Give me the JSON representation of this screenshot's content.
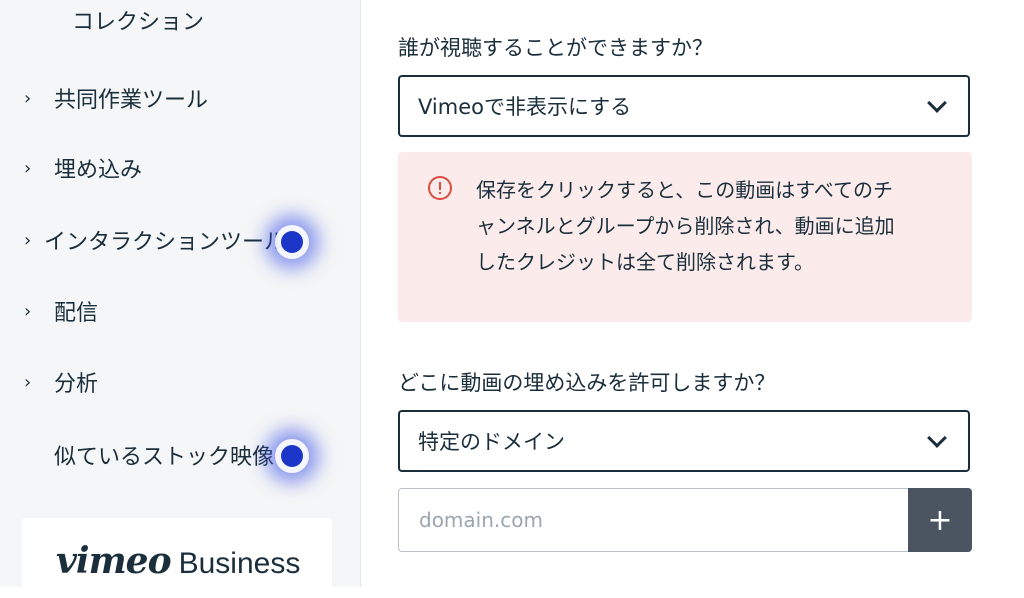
{
  "sidebar": {
    "collection_label": "コレクション",
    "items": [
      {
        "label": "共同作業ツール",
        "chevron": "›"
      },
      {
        "label": "埋め込み",
        "chevron": "›"
      },
      {
        "label": "インタラクションツール",
        "chevron": "›"
      },
      {
        "label": "配信",
        "chevron": "›"
      },
      {
        "label": "分析",
        "chevron": "›"
      },
      {
        "label": "似ているストック映像"
      }
    ],
    "brand": {
      "wordmark": "vimeo",
      "suffix": "Business"
    }
  },
  "privacy": {
    "question": "誰が視聴することができますか？",
    "selected": "Vimeoで非表示にする",
    "warning_text": "保存をクリックすると、この動画はすべてのチャンネルとグループから削除され、動画に追加したクレジットは全て削除されます。"
  },
  "embed": {
    "question": "どこに動画の埋め込みを許可しますか？",
    "selected": "特定のドメイン",
    "domain_placeholder": "domain.com",
    "add_label": "+"
  },
  "colors": {
    "warning_bg": "#fbeceb",
    "warning_icon": "#e0493f",
    "cursor_highlight": "#1c36c7",
    "add_button_bg": "#4a5561"
  }
}
